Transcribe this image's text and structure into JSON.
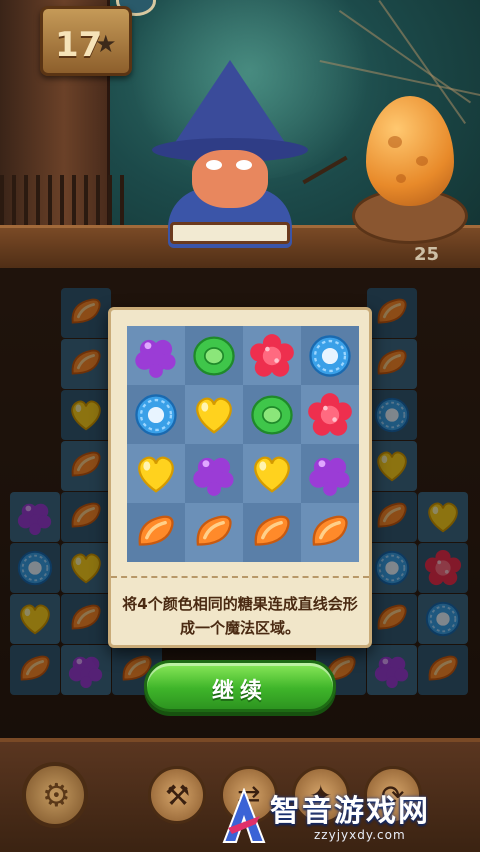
{
  "game": {
    "level": "17",
    "moves": "25"
  },
  "board": {
    "rows": [
      [
        "empty",
        "orange",
        "empty",
        "empty",
        "empty",
        "empty",
        "empty",
        "orange",
        "empty"
      ],
      [
        "empty",
        "orange",
        "empty",
        "empty",
        "empty",
        "empty",
        "empty",
        "orange",
        "empty"
      ],
      [
        "empty",
        "yellow-heart",
        "empty",
        "empty",
        "empty",
        "empty",
        "empty",
        "blue-ring",
        "empty"
      ],
      [
        "empty",
        "orange",
        "empty",
        "empty",
        "empty",
        "empty",
        "empty",
        "yellow-heart",
        "empty"
      ],
      [
        "purple-grape",
        "orange",
        "empty",
        "empty",
        "empty",
        "empty",
        "empty",
        "orange",
        "yellow-heart"
      ],
      [
        "blue-ring",
        "yellow-heart",
        "empty",
        "empty",
        "empty",
        "empty",
        "empty",
        "blue-ring",
        "red-flower"
      ],
      [
        "yellow-heart",
        "orange",
        "empty",
        "empty",
        "empty",
        "empty",
        "empty",
        "orange",
        "blue-ring"
      ],
      [
        "orange",
        "purple-grape",
        "orange",
        "empty",
        "empty",
        "empty",
        "orange",
        "purple-grape",
        "orange"
      ]
    ]
  },
  "tutorial": {
    "demo_grid": [
      [
        "purple-grape",
        "green-ring",
        "red-flower",
        "blue-ring"
      ],
      [
        "blue-ring",
        "yellow-heart",
        "green-ring",
        "red-flower"
      ],
      [
        "yellow-heart",
        "purple-grape",
        "yellow-heart",
        "purple-grape"
      ],
      [
        "orange",
        "orange",
        "orange",
        "orange"
      ]
    ],
    "text": "将4个颜色相同的糖果连成直线会形成一个魔法区域。",
    "continue_label": "继续"
  },
  "watermark": {
    "name": "智音游戏网",
    "url": "zzyjyxdy.com"
  },
  "colors": {
    "orange": "#ff8a2a",
    "purple": "#9b3cd6",
    "green": "#3fc64a",
    "red": "#ee2f4e",
    "blue": "#3aa0e8",
    "yellow": "#ffd21e",
    "button_green": "#3fb52a"
  }
}
